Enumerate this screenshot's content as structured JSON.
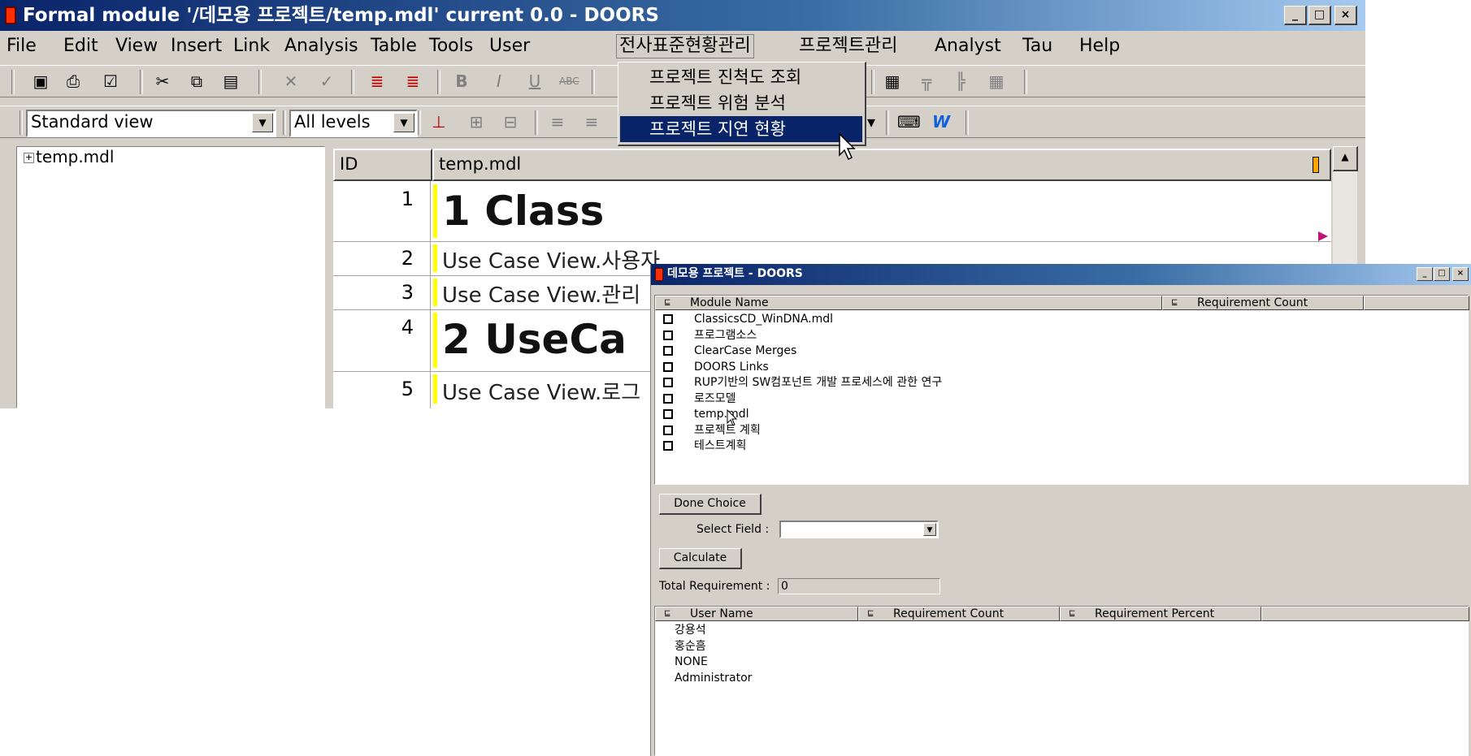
{
  "main_window": {
    "title": "Formal module '/데모용 프로젝트/temp.mdl' current 0.0 - DOORS",
    "caption_buttons": {
      "minimize": "_",
      "maximize": "□",
      "close": "×"
    },
    "menu": [
      "File",
      "Edit",
      "View",
      "Insert",
      "Link",
      "Analysis",
      "Table",
      "Tools",
      "User",
      "전사표준현황관리",
      "프로젝트관리",
      "Analyst",
      "Tau",
      "Help"
    ],
    "dropdown_items": [
      "프로젝트 진척도 조회",
      "프로젝트 위험 분석",
      "프로젝트 지연 현황"
    ],
    "view_combo": "Standard view",
    "levels_combo": "All levels",
    "tree_node": "temp.mdl",
    "grid_headers": {
      "id": "ID",
      "col": "temp.mdl"
    },
    "rows": [
      {
        "id": "1",
        "text": "1 Class"
      },
      {
        "id": "2",
        "text": "Use Case View.사용자"
      },
      {
        "id": "3",
        "text": "Use Case View.관리"
      },
      {
        "id": "4",
        "text": "2 UseCa"
      },
      {
        "id": "5",
        "text": "Use Case View.로그"
      }
    ]
  },
  "analysis_window": {
    "title": "데모용 프로젝트 - DOORS",
    "caption_buttons": {
      "minimize": "_",
      "maximize": "□",
      "close": "×"
    },
    "modules_headers": {
      "name": "Module Name",
      "count": "Requirement Count"
    },
    "modules": [
      "ClassicsCD_WinDNA.mdl",
      "프로그램소스",
      "ClearCase Merges",
      "DOORS Links",
      "RUP기반의 SW컴포넌트 개발 프로세스에 관한 연구",
      "로즈모델",
      "temp.mdl",
      "프로젝트 계획",
      "테스트계획"
    ],
    "done_choice_label": "Done Choice",
    "select_field_label": "Select Field :",
    "select_field_value": "",
    "calculate_label": "Calculate",
    "total_req_label": "Total Requirement :",
    "total_req_value": "0",
    "users_headers": {
      "name": "User Name",
      "count": "Requirement Count",
      "percent": "Requirement Percent"
    },
    "users": [
      "강용석",
      "홍순흠",
      "NONE",
      "Administrator"
    ]
  }
}
